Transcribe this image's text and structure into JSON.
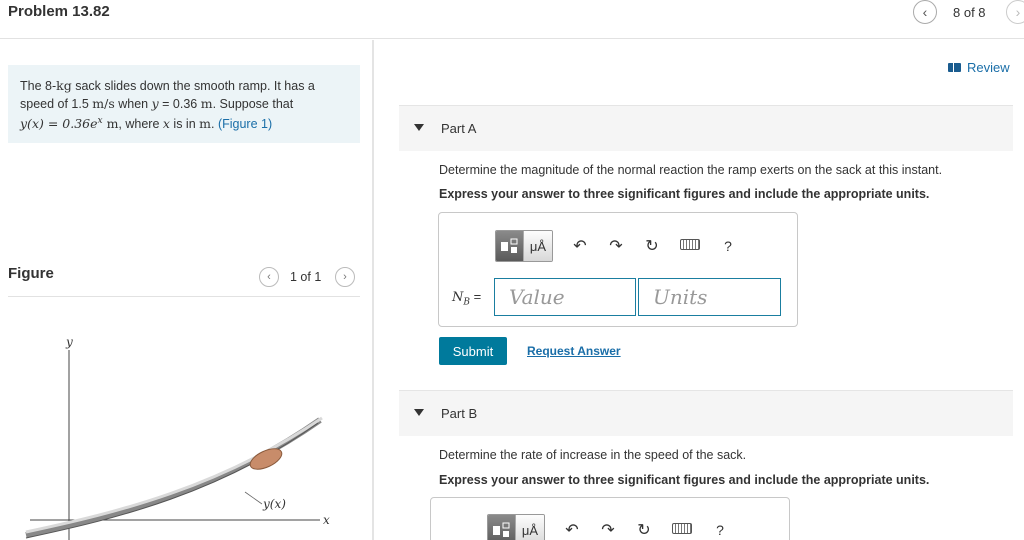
{
  "header": {
    "title": "Problem 13.82",
    "pager": "8 of 8",
    "prev_icon": "chevron-left-icon",
    "next_icon": "chevron-right-icon"
  },
  "problem": {
    "text_a": "The 8-",
    "unit_kg": "kg",
    "text_b": " sack slides down the smooth ramp. It has a speed of 1.5 ",
    "unit_speed": "m/s",
    "text_c": " when ",
    "var_y": "y",
    "text_d": " = 0.36 ",
    "unit_m": "m",
    "text_e": ". Suppose that",
    "equation": "y(x) = 0.36e",
    "exponent": "x",
    "unit_m2": " m",
    "text_f": ", where ",
    "var_x": "x",
    "text_g": " is in ",
    "unit_m3": "m",
    "text_h": ". ",
    "figure_link": "(Figure 1)"
  },
  "figure": {
    "label": "Figure",
    "pager": "1 of 1",
    "axis_y": "y",
    "axis_x": "x",
    "curve_label": "y(x)"
  },
  "review": {
    "label": "Review"
  },
  "partA": {
    "label": "Part A",
    "question": "Determine the magnitude of the normal reaction the ramp exerts on the sack at this instant.",
    "instruction": "Express your answer to three significant figures and include the appropriate units.",
    "var_label": "N",
    "var_sub": "B",
    "equals": " =",
    "value_placeholder": "Value",
    "units_placeholder": "Units",
    "tb_mu": "μÅ",
    "tb_help": "?",
    "submit": "Submit",
    "request": "Request Answer"
  },
  "partB": {
    "label": "Part B",
    "question": "Determine the rate of increase in the speed of the sack.",
    "instruction": "Express your answer to three significant figures and include the appropriate units.",
    "tb_mu": "μÅ",
    "tb_help": "?"
  },
  "colors": {
    "accent": "#007a9c",
    "link": "#1a6ea8",
    "problem_bg": "#ecf4f7"
  }
}
